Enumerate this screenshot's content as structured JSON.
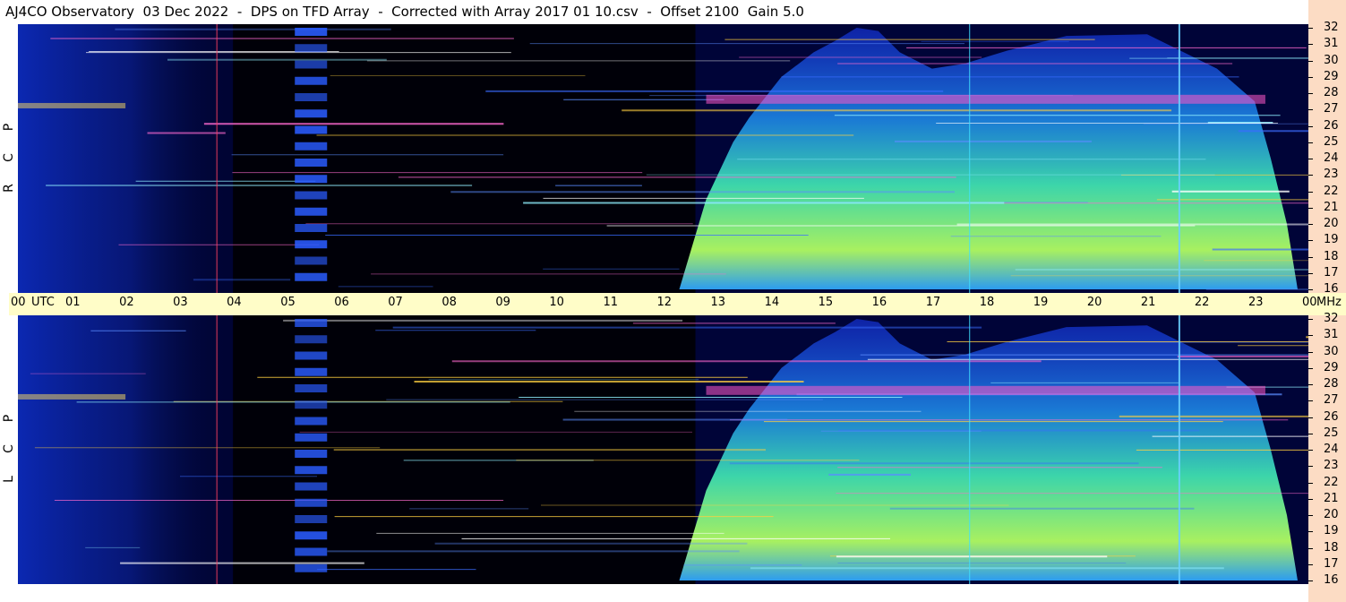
{
  "title": "AJ4CO Observatory  03 Dec 2022  -  DPS on TFD Array  -  Corrected with Array 2017 01 10.csv  -  Offset 2100  Gain 5.0",
  "colors": {
    "background": "#000000",
    "timebar": "#fffdc8",
    "freq_strip": "#fcdcc4",
    "cursor_blue": "#6ad0ff",
    "cursor_red": "#ff4060",
    "cursor_cyan": "#40e0ff"
  },
  "chart_data": [
    {
      "type": "heatmap",
      "title": "",
      "xlabel": "UTC",
      "ylabel": "MHz",
      "channel_letters": [
        "R",
        "C",
        "P"
      ],
      "x_range": [
        0,
        24
      ],
      "ylim": [
        16,
        32
      ],
      "x_ticks": [
        "00",
        "UTC",
        "01",
        "02",
        "03",
        "04",
        "05",
        "06",
        "07",
        "08",
        "09",
        "10",
        "11",
        "12",
        "13",
        "14",
        "15",
        "16",
        "17",
        "18",
        "19",
        "20",
        "21",
        "22",
        "23",
        "00",
        "MHz"
      ],
      "y_ticks": [
        "32",
        "31",
        "30",
        "29",
        "28",
        "27",
        "26",
        "25",
        "24",
        "23",
        "22",
        "21",
        "20",
        "19",
        "18",
        "17",
        "16"
      ],
      "cursor_lines_utc": [
        3.7,
        17.7,
        21.6
      ]
    },
    {
      "type": "heatmap",
      "title": "",
      "xlabel": "UTC",
      "ylabel": "MHz",
      "channel_letters": [
        "L",
        "C",
        "P"
      ],
      "x_range": [
        0,
        24
      ],
      "ylim": [
        16,
        32
      ],
      "y_ticks": [
        "32",
        "31",
        "30",
        "29",
        "28",
        "27",
        "26",
        "25",
        "24",
        "23",
        "22",
        "21",
        "20",
        "19",
        "18",
        "17",
        "16"
      ],
      "cursor_lines_utc": [
        3.7,
        17.7,
        21.6
      ]
    }
  ],
  "axis_text": {
    "utc_label": "UTC",
    "mhz_label": "MHz",
    "hours": [
      "00",
      "01",
      "02",
      "03",
      "04",
      "05",
      "06",
      "07",
      "08",
      "09",
      "10",
      "11",
      "12",
      "13",
      "14",
      "15",
      "16",
      "17",
      "18",
      "19",
      "20",
      "21",
      "22",
      "23",
      "00"
    ],
    "freqs": [
      "32",
      "31",
      "30",
      "29",
      "28",
      "27",
      "26",
      "25",
      "24",
      "23",
      "22",
      "21",
      "20",
      "19",
      "18",
      "17",
      "16"
    ]
  },
  "channels": {
    "top": [
      "R",
      "C",
      "P"
    ],
    "bottom": [
      "L",
      "C",
      "P"
    ]
  }
}
